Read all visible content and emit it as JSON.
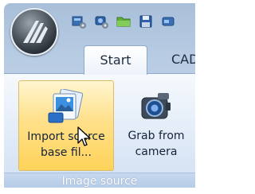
{
  "app": {
    "orb_icon": "app-logo-icon"
  },
  "quick_access": {
    "items": [
      {
        "icon": "open-folder-settings-icon"
      },
      {
        "icon": "camera-settings-icon"
      },
      {
        "icon": "folder-icon"
      },
      {
        "icon": "save-icon"
      },
      {
        "icon": "tool-icon"
      }
    ]
  },
  "tabs": [
    {
      "label": "Start",
      "active": true
    },
    {
      "label": "CAD",
      "active": false
    }
  ],
  "ribbon": {
    "group_label": "Image source",
    "buttons": [
      {
        "label_line1": "Import source",
        "label_line2": "base fil...",
        "icon": "import-image-icon",
        "state": "hover"
      },
      {
        "label_line1": "Grab from",
        "label_line2": "camera",
        "icon": "camera-icon"
      }
    ]
  },
  "colors": {
    "hover_highlight": "#ffe08a",
    "ribbon_group_bar": "#b4cae6"
  }
}
